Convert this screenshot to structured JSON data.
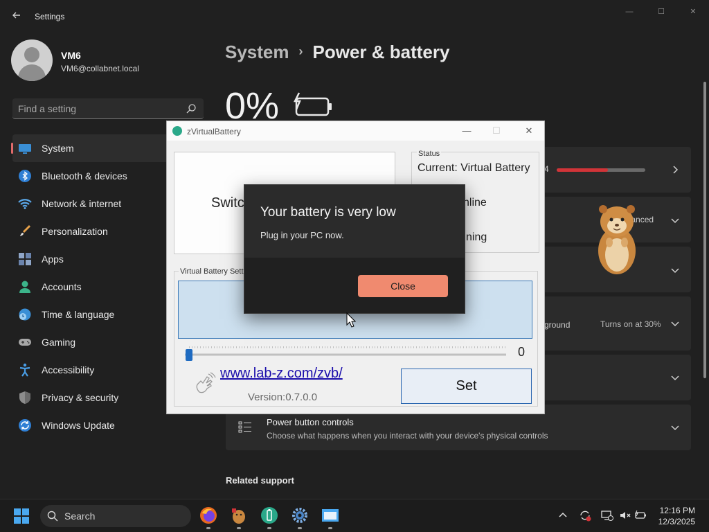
{
  "window": {
    "app_title": "Settings",
    "minimize": "—",
    "maximize": "☐",
    "close": "✕"
  },
  "user": {
    "name": "VM6",
    "email": "VM6@collabnet.local"
  },
  "search": {
    "placeholder": "Find a setting"
  },
  "sidebar": {
    "items": [
      {
        "label": "System",
        "icon": "system-icon",
        "active": true
      },
      {
        "label": "Bluetooth & devices",
        "icon": "bluetooth-icon"
      },
      {
        "label": "Network & internet",
        "icon": "wifi-icon"
      },
      {
        "label": "Personalization",
        "icon": "brush-icon"
      },
      {
        "label": "Apps",
        "icon": "apps-icon"
      },
      {
        "label": "Accounts",
        "icon": "person-icon"
      },
      {
        "label": "Time & language",
        "icon": "clock-globe-icon"
      },
      {
        "label": "Gaming",
        "icon": "gamepad-icon"
      },
      {
        "label": "Accessibility",
        "icon": "accessibility-icon"
      },
      {
        "label": "Privacy & security",
        "icon": "shield-icon"
      },
      {
        "label": "Windows Update",
        "icon": "update-icon"
      }
    ]
  },
  "breadcrumb": {
    "parent": "System",
    "separator": "›",
    "current": "Power & battery"
  },
  "battery": {
    "percent_text": "0%"
  },
  "cards": {
    "usage_label_fragment": "4",
    "power_mode_value_fragment": "alanced",
    "saver_fragment": "ground",
    "saver_value": "Turns on at 30%",
    "power_button": {
      "title": "Power button controls",
      "subtitle": "Choose what happens when you interact with your device's physical controls"
    }
  },
  "related_support": "Related support",
  "zvb": {
    "title": "zVirtualBattery",
    "switch_label_fragment": "Switc",
    "status_legend": "Status",
    "status_current": "Current: Virtual Battery",
    "status_line2_fragment": "nline",
    "status_line3_fragment": "ning",
    "settings_legend": "Virtual Battery Settin",
    "slider_value": "0",
    "link": "www.lab-z.com/zvb/",
    "version": "Version:0.7.0.0",
    "set_label": "Set"
  },
  "dialog": {
    "title": "Your battery is very low",
    "message": "Plug in your PC now.",
    "close_label": "Close"
  },
  "taskbar": {
    "search_label": "Search",
    "time": "12:16 PM",
    "date": "12/3/2025"
  },
  "colors": {
    "accent_red": "#d13438",
    "dialog_button": "#f08a6f",
    "zvb_green": "#2aa889"
  }
}
